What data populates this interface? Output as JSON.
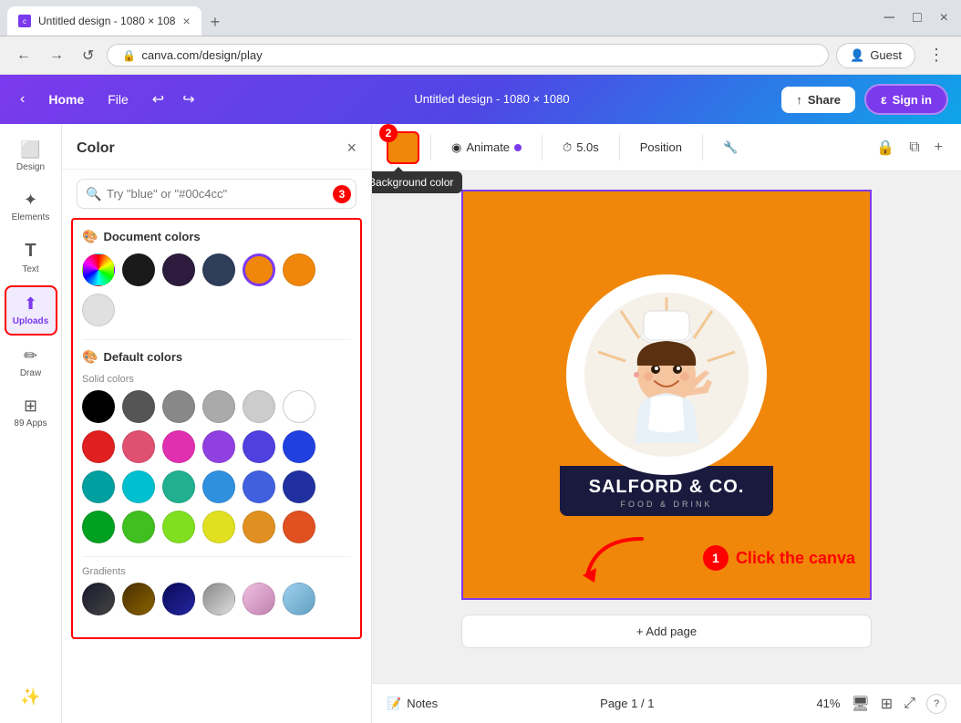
{
  "browser": {
    "tab_active_title": "Untitled design - 1080 × 108",
    "tab_close": "×",
    "tab_new": "+",
    "nav_back": "←",
    "nav_forward": "→",
    "nav_refresh": "↺",
    "address_url": "canva.com/design/play",
    "guest_btn": "Guest",
    "menu_dots": "⋮"
  },
  "canva_topbar": {
    "back_arrow": "‹",
    "home_label": "Home",
    "file_label": "File",
    "undo_icon": "↩",
    "redo_icon": "↪",
    "title": "Untitled design - 1080 × 1080",
    "share_label": "Share",
    "signin_label": "Sign in"
  },
  "sidebar": {
    "items": [
      {
        "id": "design",
        "label": "Design",
        "icon": "⬜"
      },
      {
        "id": "elements",
        "label": "Elements",
        "icon": "✦"
      },
      {
        "id": "text",
        "label": "Text",
        "icon": "T"
      },
      {
        "id": "uploads",
        "label": "Uploads",
        "icon": "↑"
      },
      {
        "id": "draw",
        "label": "Draw",
        "icon": "✏"
      },
      {
        "id": "apps",
        "label": "89 Apps",
        "icon": "⊞"
      }
    ],
    "bottom_icon": "✦"
  },
  "color_panel": {
    "title": "Color",
    "close_btn": "×",
    "search_placeholder": "Try \"blue\" or \"#00c4cc\"",
    "search_badge": "3",
    "document_colors_title": "Document colors",
    "document_swatches": [
      {
        "color": "rainbow",
        "label": "rainbow"
      },
      {
        "color": "#1a1a1a",
        "label": "black"
      },
      {
        "color": "#2d1b3d",
        "label": "dark purple"
      },
      {
        "color": "#2d3d5a",
        "label": "dark blue"
      },
      {
        "color": "#f0870a",
        "label": "orange outlined"
      },
      {
        "color": "#f0870a",
        "label": "orange"
      },
      {
        "color": "#e0e0e0",
        "label": "light grey"
      }
    ],
    "default_colors_title": "Default colors",
    "solid_colors_label": "Solid colors",
    "solid_swatches": [
      "#000000",
      "#555555",
      "#888888",
      "#aaaaaa",
      "#cccccc",
      "#ffffff",
      "#e02020",
      "#e05070",
      "#e030b0",
      "#9040e0",
      "#5040e0",
      "#2040e0",
      "#00a0a0",
      "#00c0d0",
      "#00c0a0",
      "#3090e0",
      "#4060e0",
      "#2030a0",
      "#00a020",
      "#40c020",
      "#80e020",
      "#e0e020",
      "#e09020",
      "#e05020"
    ],
    "gradients_label": "Gradients"
  },
  "canvas_toolbar": {
    "color_preview": "#f0870a",
    "color_tooltip": "Background color",
    "badge_2": "2",
    "animate_label": "Animate",
    "animate_dot_color": "#7c3aed",
    "timer_icon": "⏱",
    "timer_label": "5.0s",
    "position_label": "Position",
    "wrench_icon": "🔧"
  },
  "design_canvas": {
    "background_color": "#f0870a",
    "logo_emoji": "👩‍🍳",
    "brand_name": "SALFORD & CO.",
    "brand_subtitle": "FOOD & DRINK"
  },
  "annotation1": {
    "badge": "1",
    "text": "Click the canva"
  },
  "bottom_bar": {
    "notes_icon": "📝",
    "notes_label": "Notes",
    "page_info": "Page 1 / 1",
    "zoom_level": "41%",
    "desktop_icon": "🖥",
    "grid_icon": "⊞",
    "expand_icon": "⤢",
    "help_icon": "?"
  },
  "add_page_btn": "+ Add page"
}
